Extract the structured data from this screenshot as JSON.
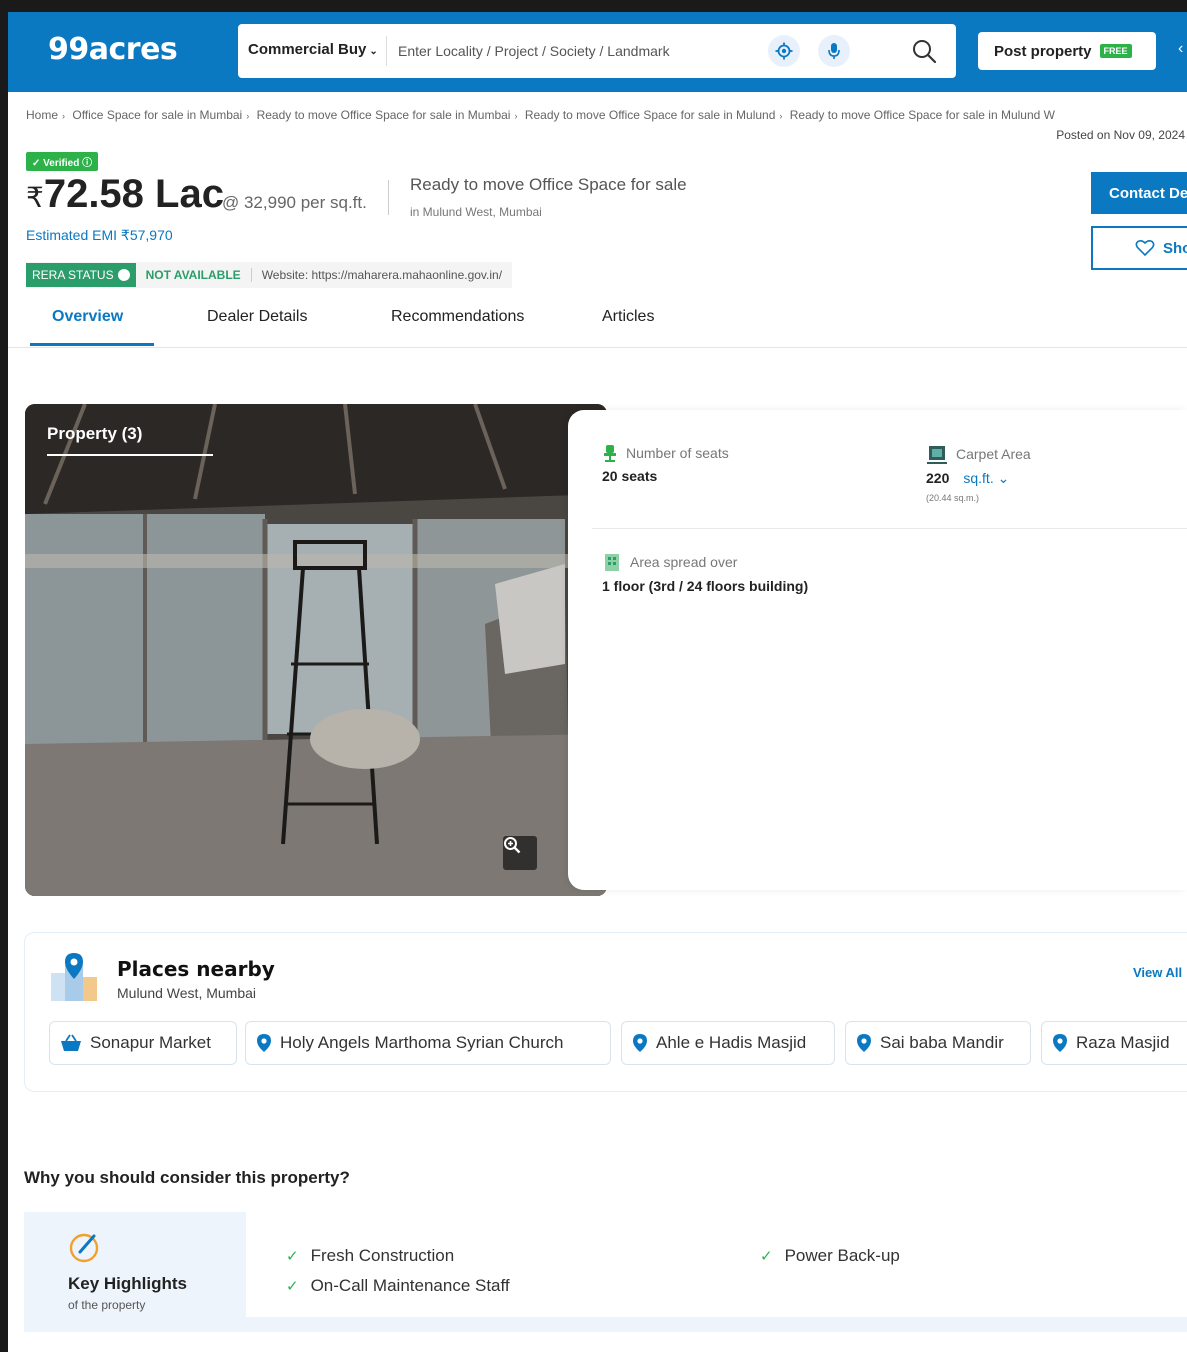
{
  "header": {
    "logo": "99acres",
    "search_type": "Commercial Buy",
    "search_placeholder": "Enter Locality / Project / Society / Landmark",
    "post_property": "Post property",
    "free_badge": "FREE",
    "brand_color": "#0b78c2"
  },
  "breadcrumb": {
    "items": [
      "Home",
      "Office Space for sale in Mumbai",
      "Ready to move Office Space for sale in Mumbai",
      "Ready to move Office Space for sale in Mulund",
      "Ready to move Office Space for sale in Mulund W"
    ],
    "posted": "Posted on Nov 09, 2024"
  },
  "listing": {
    "verified": "Verified",
    "price_symbol": "₹",
    "price": "72.58 Lac",
    "price_per": "@ 32,990 per sq.ft.",
    "emi": "Estimated EMI ₹57,970",
    "title": "Ready to move Office Space for sale",
    "location": "in Mulund West, Mumbai",
    "contact_label": "Contact Dealer",
    "shortlist_label": "Shortlist",
    "rera_label": "RERA STATUS",
    "rera_status": "NOT AVAILABLE",
    "rera_site": "Website: https://maharera.mahaonline.gov.in/"
  },
  "tabs": [
    {
      "label": "Overview"
    },
    {
      "label": "Dealer Details"
    },
    {
      "label": "Recommendations"
    },
    {
      "label": "Articles"
    }
  ],
  "gallery": {
    "title": "Property (3)"
  },
  "details": {
    "seats_label": "Number of seats",
    "seats_value": "20 seats",
    "carpet_label": "Carpet Area",
    "carpet_value": "220",
    "carpet_unit": "sq.ft.",
    "carpet_sub": "(20.44 sq.m.)",
    "spread_label": "Area spread over",
    "spread_value": "1 floor (3rd / 24 floors building)"
  },
  "places": {
    "title": "Places nearby",
    "subtitle": "Mulund West, Mumbai",
    "view_all": "View All",
    "items": [
      {
        "label": "Sonapur Market",
        "icon": "shopping-basket-icon"
      },
      {
        "label": "Holy Angels Marthoma Syrian Church",
        "icon": "location-pin-icon"
      },
      {
        "label": "Ahle e Hadis Masjid",
        "icon": "location-pin-icon"
      },
      {
        "label": "Sai baba Mandir",
        "icon": "location-pin-icon"
      },
      {
        "label": "Raza Masjid",
        "icon": "location-pin-icon"
      }
    ]
  },
  "why": {
    "title": "Why you should consider this property?",
    "highlights_title": "Key Highlights",
    "highlights_sub": "of the property",
    "items": [
      "Fresh Construction",
      "Power Back-up",
      "On-Call Maintenance Staff"
    ]
  }
}
